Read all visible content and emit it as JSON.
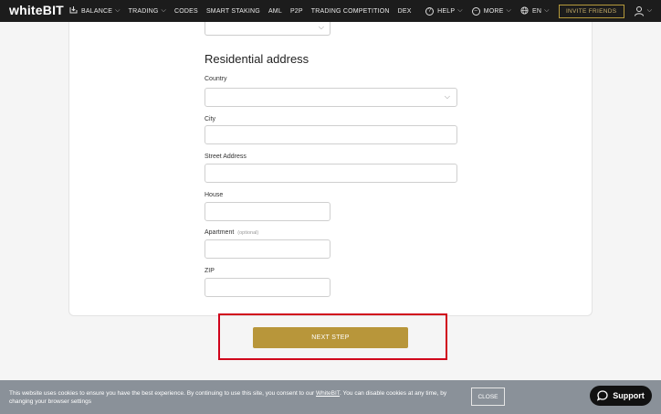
{
  "nav": {
    "logo_main": "white",
    "logo_accent": "BIT",
    "items": [
      {
        "label": "BALANCE",
        "has_chevron": true
      },
      {
        "label": "TRADING",
        "has_chevron": true
      },
      {
        "label": "CODES"
      },
      {
        "label": "SMART STAKING"
      },
      {
        "label": "AML"
      },
      {
        "label": "P2P"
      },
      {
        "label": "TRADING COMPETITION"
      },
      {
        "label": "DEX"
      }
    ],
    "help": "HELP",
    "more": "MORE",
    "lang": "EN",
    "invite": "INVITE FRIENDS"
  },
  "form": {
    "section_title": "Residential address",
    "country_label": "Country",
    "country_value": "",
    "city_label": "City",
    "city_value": "",
    "street_label": "Street Address",
    "street_value": "",
    "house_label": "House",
    "house_value": "",
    "apartment_label": "Apartment",
    "apartment_optional": "(optional)",
    "apartment_value": "",
    "zip_label": "ZIP",
    "zip_value": ""
  },
  "next_step_label": "NEXT STEP",
  "cookie": {
    "text_before": "This website uses cookies to ensure you have the best experience. By continuing to use this site, you consent to our ",
    "link": "WhiteBIT",
    "text_after": ". You can disable cookies at any time, by changing your browser settings",
    "close": "CLOSE"
  },
  "support_label": "Support",
  "colors": {
    "nav_bg": "#1c1c1c",
    "accent_gold": "#b8963a",
    "highlight_red": "#d0021b",
    "cookie_bg": "#8a9199"
  }
}
